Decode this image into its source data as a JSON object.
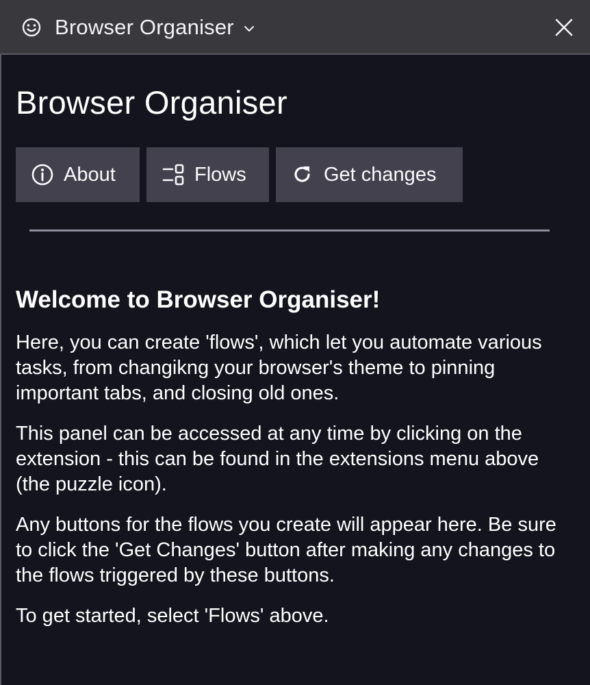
{
  "titlebar": {
    "title": "Browser Organiser",
    "icon": "smiley-icon",
    "dropdown_icon": "chevron-down-icon",
    "close_icon": "close-icon"
  },
  "main": {
    "heading": "Browser Organiser",
    "nav": {
      "about": {
        "label": "About",
        "icon": "info-icon"
      },
      "flows": {
        "label": "Flows",
        "icon": "flows-icon"
      },
      "get_changes": {
        "label": "Get changes",
        "icon": "refresh-icon"
      }
    },
    "welcome_heading": "Welcome to Browser Organiser!",
    "paragraphs": [
      "Here, you can create 'flows', which let you automate various tasks, from changikng your browser's theme to pinning important tabs, and closing old ones.",
      "This panel can be accessed at any time by clicking on the extension - this can be found in the extensions menu above (the puzzle icon).",
      "Any buttons for the flows you create will appear here. Be sure to click the 'Get Changes' button after making any changes to the flows triggered by these buttons.",
      "To get started, select 'Flows' above."
    ]
  },
  "colors": {
    "background": "#14141f",
    "titlebar": "#38383d",
    "button": "#42414d",
    "divider": "#8f8f9d",
    "text": "#ffffff"
  }
}
